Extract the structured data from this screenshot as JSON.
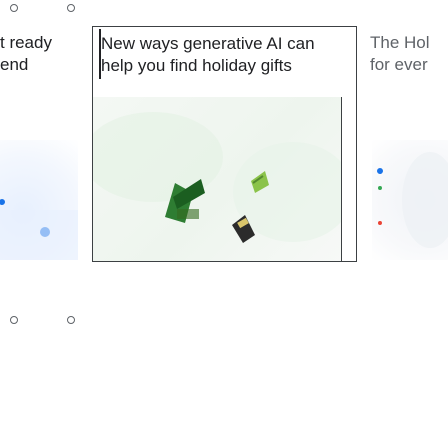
{
  "cards": {
    "left": {
      "title_line1": "t ready",
      "title_line2": "end"
    },
    "focused": {
      "title_line1": "New ways generative AI can",
      "title_line2": "help you find holiday gifts"
    },
    "right": {
      "title_line1": "The Hol",
      "title_line2": "for ever"
    }
  },
  "icons": {
    "carousel_dot": "circle-outline-icon",
    "gift_art": "gift-illustration-icon"
  },
  "colors": {
    "text": "#202124",
    "muted_text": "#5f6368",
    "focus_border": "#3c4043",
    "accent_blue": "#1a73e8",
    "accent_green": "#34a853"
  }
}
